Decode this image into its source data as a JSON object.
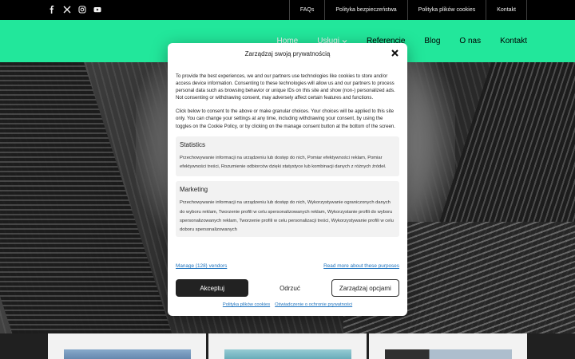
{
  "topbar": {
    "social_icons": [
      "facebook-icon",
      "x-icon",
      "instagram-icon",
      "youtube-icon"
    ],
    "links": [
      "FAQs",
      "Polityka bezpieczeństwa",
      "Polityka plików cookies",
      "Kontakt"
    ]
  },
  "nav": {
    "items": [
      {
        "label": "Home"
      },
      {
        "label": "Usługi"
      },
      {
        "label": "Referencje"
      },
      {
        "label": "Blog"
      },
      {
        "label": "O nas"
      },
      {
        "label": "Kontakt"
      }
    ],
    "accent": "#24f4a4"
  },
  "modal": {
    "title": "Zarządzaj swoją prywatnością",
    "intro": "To provide the best experiences, we and our partners use technologies like cookies to store and/or access device information. Consenting to these technologies will allow us and our partners to process personal data such as browsing behavior or unique IDs on this site and show (non-) personalized ads. Not consenting or withdrawing consent, may adversely affect certain features and functions.",
    "consent_text": "Click below to consent to the above or make granular choices. Your choices will be applied to this site only. You can change your settings at any time, including withdrawing your consent, by using the toggles on the Cookie Policy, or by clicking on the manage consent button at the bottom of the screen.",
    "sections": [
      {
        "title": "Statistics",
        "description": "Przechowywanie informacji na urządzeniu lub dostęp do nich, Pomiar efektywności reklam, Pomiar efektywności treści, Rozumienie odbiorców dzięki statystyce lub kombinacji danych z różnych źródeł."
      },
      {
        "title": "Marketing",
        "description": "Przechowywanie informacji na urządzeniu lub dostęp do nich, Wykorzystywanie ograniczonych danych do wyboru reklam, Tworzenie profili w celu spersonalizowanych reklam, Wykorzystanie profili do wyboru spersonalizowanych reklam, Tworzenie profili w celu personalizacji treści, Wykorzystywanie profili w celu doboru spersonalizowanych"
      }
    ],
    "manage_vendors": "Manage {128} vendors",
    "read_more": "Read more about these purposes",
    "buttons": {
      "accept": "Akceptuj",
      "deny": "Odrzuć",
      "preferences": "Zarządzaj opcjami"
    },
    "footer_links": [
      "Polityka plików cookies",
      "Oświadczenie o ochronie prywatności"
    ]
  }
}
